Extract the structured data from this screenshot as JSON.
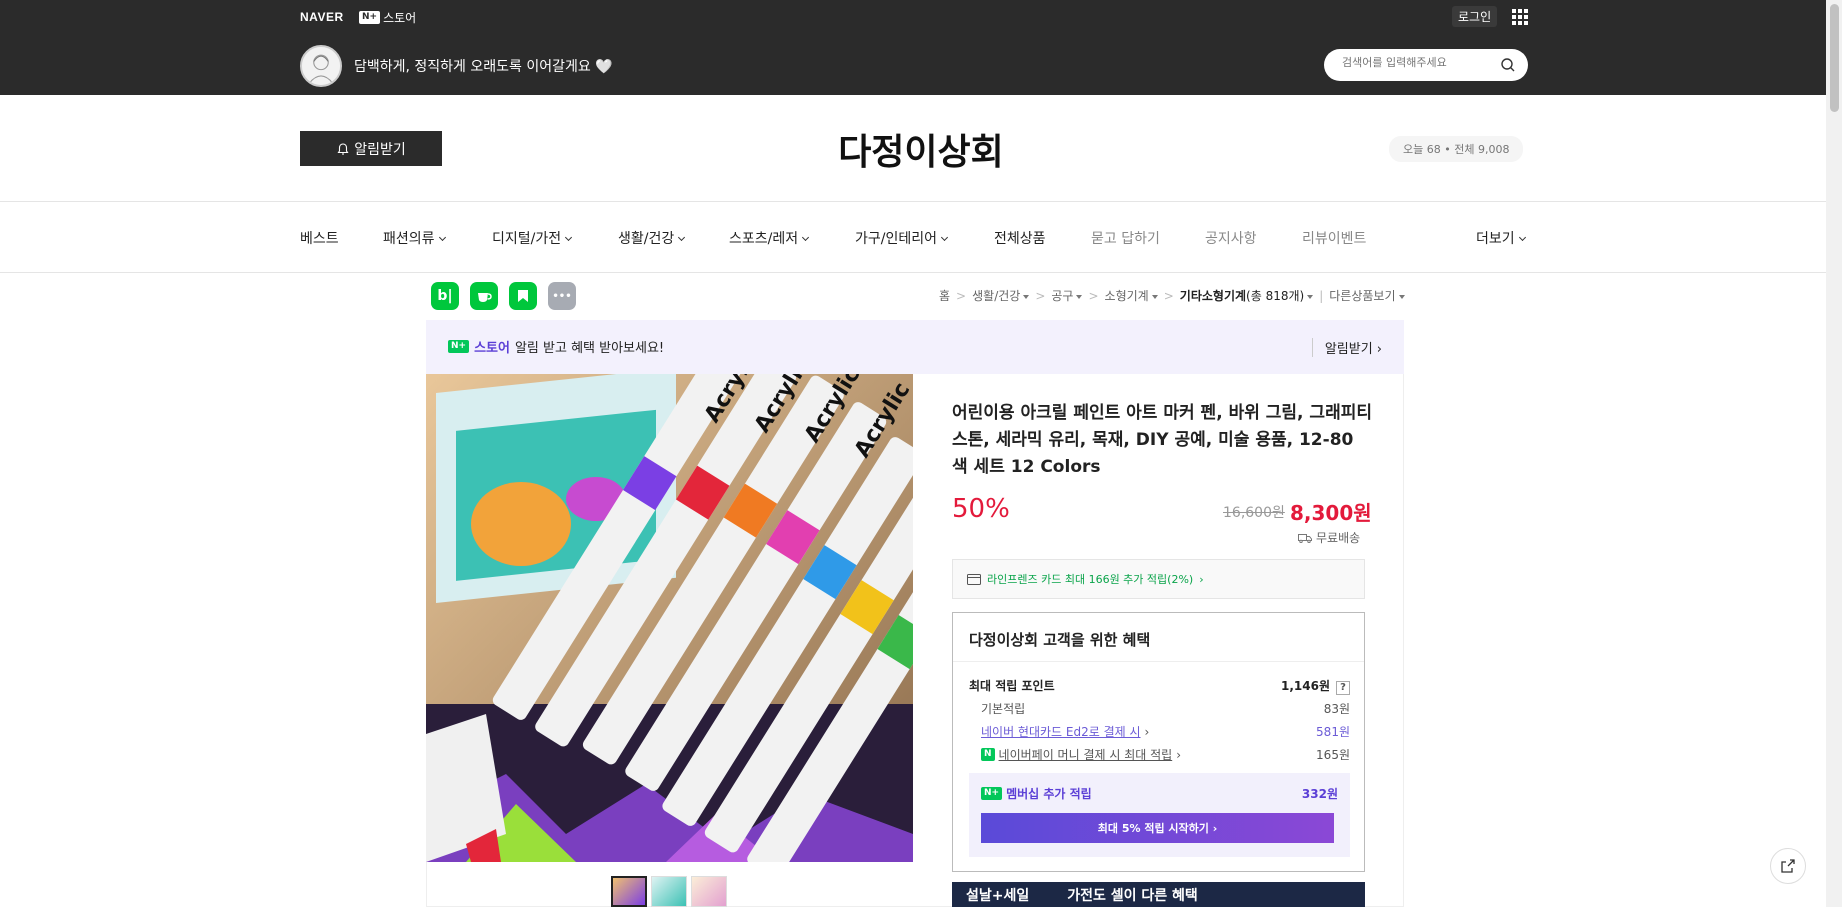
{
  "topbar": {
    "naver_logo": "NAVER",
    "np_badge": "N+",
    "np_store": "스토어",
    "login": "로그인",
    "slogan": "담백하게, 정직하게 오래도록 이어갈게요 🤍",
    "search_placeholder": "검색어를 입력해주세요"
  },
  "header": {
    "alert_button": "알림받기",
    "store_name": "다정이상회",
    "visit_counter": "오늘 68 • 전체 9,008"
  },
  "nav": {
    "items": [
      {
        "label": "베스트",
        "dropdown": false
      },
      {
        "label": "패션의류",
        "dropdown": true
      },
      {
        "label": "디지털/가전",
        "dropdown": true
      },
      {
        "label": "생활/건강",
        "dropdown": true
      },
      {
        "label": "스포츠/레저",
        "dropdown": true
      },
      {
        "label": "가구/인테리어",
        "dropdown": true
      },
      {
        "label": "전체상품",
        "dropdown": false
      },
      {
        "label": "묻고 답하기",
        "dropdown": false
      },
      {
        "label": "공지사항",
        "dropdown": false
      },
      {
        "label": "리뷰이벤트",
        "dropdown": false
      }
    ],
    "more": "더보기"
  },
  "share_icons": [
    "blog-icon",
    "cafe-icon",
    "bookmark-icon",
    "more-icon"
  ],
  "share_labels": {
    "blog": "b|",
    "more": "•••"
  },
  "breadcrumb": {
    "home": "홈",
    "cat1": "생활/건강",
    "cat2": "공구",
    "cat3": "소형기계",
    "cat4": "기타소형기계",
    "cat4_count": "(총 818개)",
    "other": "다른상품보기"
  },
  "promo": {
    "np_badge": "N+",
    "store": "스토어",
    "text": "알림 받고 혜택 받아보세요!",
    "action": "알림받기"
  },
  "product": {
    "title": "어린이용 아크릴 페인트 아트 마커 펜, 바위 그림, 그래피티 스톤, 세라믹 유리, 목재, DIY 공예, 미술 용품, 12-80 색 세트 12 Colors",
    "discount": "50%",
    "original_price": "16,600원",
    "sale_price": "8,300원",
    "shipping": "무료배송",
    "card_benefit": "라인프렌즈 카드 최대 166원 추가 적립(2%)",
    "image_label": "Acrylic"
  },
  "benefits": {
    "title": "다정이상회 고객을 위한 혜택",
    "max_points_label": "최대 적립 포인트",
    "max_points_value": "1,146원",
    "help": "?",
    "rows": [
      {
        "label": "기본적립",
        "value": "83원"
      },
      {
        "label": "네이버 현대카드 Ed2로 결제 시",
        "value": "581원"
      },
      {
        "label": "네이버페이 머니 결제 시 최대 적립",
        "value": "165원"
      }
    ],
    "npay_badge": "N",
    "membership_label": "멤버십 추가 적립",
    "membership_value": "332원",
    "membership_badge": "N+",
    "membership_button": "최대 5% 적립 시작하기"
  },
  "sale_banner": {
    "left": "설날+세일",
    "right": "가전도 셀이 다른 혜택"
  },
  "colors": {
    "topbar": "#2b2b2b",
    "accent_red": "#e31a3b",
    "naver_green": "#03c75a",
    "purple": "#5b3fd6"
  }
}
